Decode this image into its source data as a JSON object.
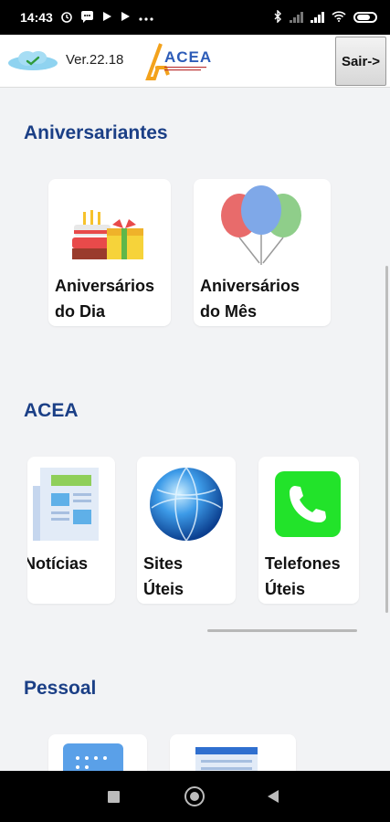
{
  "status_bar": {
    "time": "14:43"
  },
  "header": {
    "version": "Ver.22.18",
    "logo_text": "ACEA",
    "exit_button": "Sair->"
  },
  "sections": {
    "aniversariantes": {
      "title": "Aniversariantes",
      "cards": [
        {
          "label": "Aniversários\ndo Dia",
          "icon": "cake-gift-icon"
        },
        {
          "label": "Aniversários\ndo Mês",
          "icon": "balloons-icon"
        }
      ]
    },
    "acea": {
      "title": "ACEA",
      "cards": [
        {
          "label": "Notícias",
          "icon": "newspaper-icon"
        },
        {
          "label": "Sites\nÚteis",
          "icon": "globe-icon"
        },
        {
          "label": "Telefones\nÚteis",
          "icon": "phone-icon"
        }
      ]
    },
    "pessoal": {
      "title": "Pessoal",
      "cards": [
        {
          "icon": "calendar-icon"
        },
        {
          "icon": "browser-window-icon"
        }
      ]
    }
  },
  "colors": {
    "section_title": "#1b3f86",
    "content_background": "#f2f3f5",
    "phone_green": "#22e32a"
  }
}
